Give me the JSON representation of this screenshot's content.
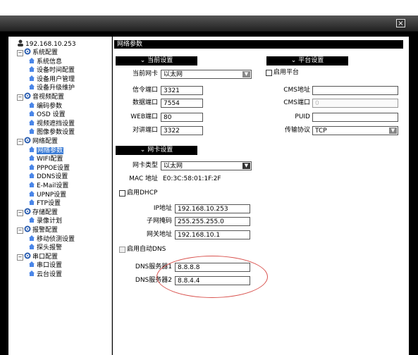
{
  "window": {
    "title": "192.168.10.253",
    "close_glyph": "×"
  },
  "tree": {
    "root": "192.168.10.253",
    "items": [
      {
        "label": "系统配置",
        "level": 1
      },
      {
        "label": "系统信息",
        "level": 2
      },
      {
        "label": "设备时间配置",
        "level": 2
      },
      {
        "label": "设备用户管理",
        "level": 2
      },
      {
        "label": "设备升级维护",
        "level": 2
      },
      {
        "label": "音视频配置",
        "level": 1
      },
      {
        "label": "编码参数",
        "level": 2
      },
      {
        "label": "OSD 设置",
        "level": 2
      },
      {
        "label": "视频遮挡设置",
        "level": 2
      },
      {
        "label": "图像参数设置",
        "level": 2
      },
      {
        "label": "网络配置",
        "level": 1
      },
      {
        "label": "网络参数",
        "level": 2,
        "selected": true
      },
      {
        "label": "WIFI配置",
        "level": 2
      },
      {
        "label": "PPPOE设置",
        "level": 2
      },
      {
        "label": "DDNS设置",
        "level": 2
      },
      {
        "label": "E-Mail设置",
        "level": 2
      },
      {
        "label": "UPNP设置",
        "level": 2
      },
      {
        "label": "FTP设置",
        "level": 2
      },
      {
        "label": "存储配置",
        "level": 1
      },
      {
        "label": "录像计划",
        "level": 2
      },
      {
        "label": "报警配置",
        "level": 1
      },
      {
        "label": "移动侦测设置",
        "level": 2
      },
      {
        "label": "探头报警",
        "level": 2
      },
      {
        "label": "串口配置",
        "level": 1
      },
      {
        "label": "串口设置",
        "level": 2
      },
      {
        "label": "云台设置",
        "level": 2
      }
    ]
  },
  "panel": {
    "title": "网络参数",
    "current": {
      "header": "当前设置",
      "nic_label": "当前网卡",
      "nic_value": "以太网",
      "cmd_port_label": "信令端口",
      "cmd_port": "3321",
      "data_port_label": "数据端口",
      "data_port": "7554",
      "web_port_label": "WEB端口",
      "web_port": "80",
      "talk_port_label": "对讲端口",
      "talk_port": "3322"
    },
    "platform": {
      "header": "平台设置",
      "enable_label": "启用平台",
      "cms_addr_label": "CMS地址",
      "cms_addr": "",
      "cms_port_label": "CMS端口",
      "cms_port": "0",
      "puid_label": "PUID",
      "puid": "",
      "protocol_label": "传输协议",
      "protocol": "TCP"
    },
    "nic": {
      "header": "网卡设置",
      "type_label": "网卡类型",
      "type_value": "以太网",
      "mac_label": "MAC 地址",
      "mac_value": "E0:3C:58:01:1F:2F",
      "dhcp_label": "启用DHCP",
      "ip_label": "IP地址",
      "ip": "192.168.10.253",
      "mask_label": "子网掩码",
      "mask": "255.255.255.0",
      "gateway_label": "网关地址",
      "gateway": "192.168.10.1",
      "auto_dns_label": "启用自动DNS",
      "dns1_label": "DNS服务器1",
      "dns1": "8.8.8.8",
      "dns2_label": "DNS服务器2",
      "dns2": "8.8.4.4"
    },
    "header_chevron": "⌄",
    "dropdown_glyph": "▼"
  },
  "colors": {
    "selected_bg": "#3a7bd5",
    "annotation": "#d9534f",
    "header_bg": "#000000"
  }
}
